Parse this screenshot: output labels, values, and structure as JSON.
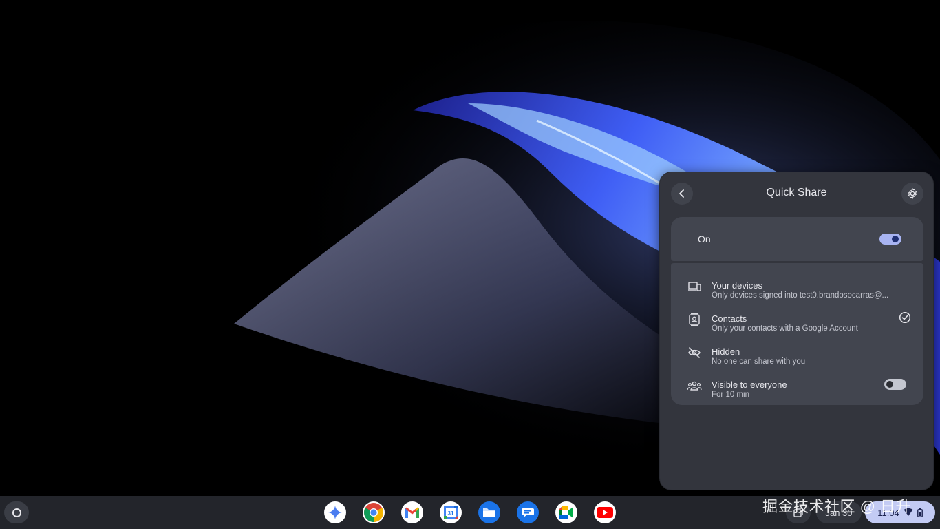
{
  "quick_share": {
    "title": "Quick Share",
    "enabled_label": "On",
    "enabled": true,
    "options": [
      {
        "title": "Your devices",
        "subtitle": "Only devices signed into test0.brandosocarras@...",
        "icon": "devices-icon"
      },
      {
        "title": "Contacts",
        "subtitle": "Only your contacts with a Google Account",
        "icon": "contacts-icon",
        "selected": true
      },
      {
        "title": "Hidden",
        "subtitle": "No one can share with you",
        "icon": "visibility-off-icon"
      },
      {
        "title": "Visible to everyone",
        "subtitle": "For 10 min",
        "icon": "group-icon",
        "toggle": false
      }
    ]
  },
  "shelf": {
    "apps": [
      "Gemini",
      "Chrome",
      "Gmail",
      "Calendar",
      "Files",
      "Messages",
      "Meet",
      "YouTube"
    ],
    "calendar_day": "31",
    "date": "Jan 30",
    "time": "11:04"
  },
  "watermark": "掘金技术社区 @ 日升",
  "colors": {
    "panel": "#33353d",
    "card": "#42454f",
    "accent": "#a8b4f2",
    "time_pill": "#c3cbf4"
  }
}
